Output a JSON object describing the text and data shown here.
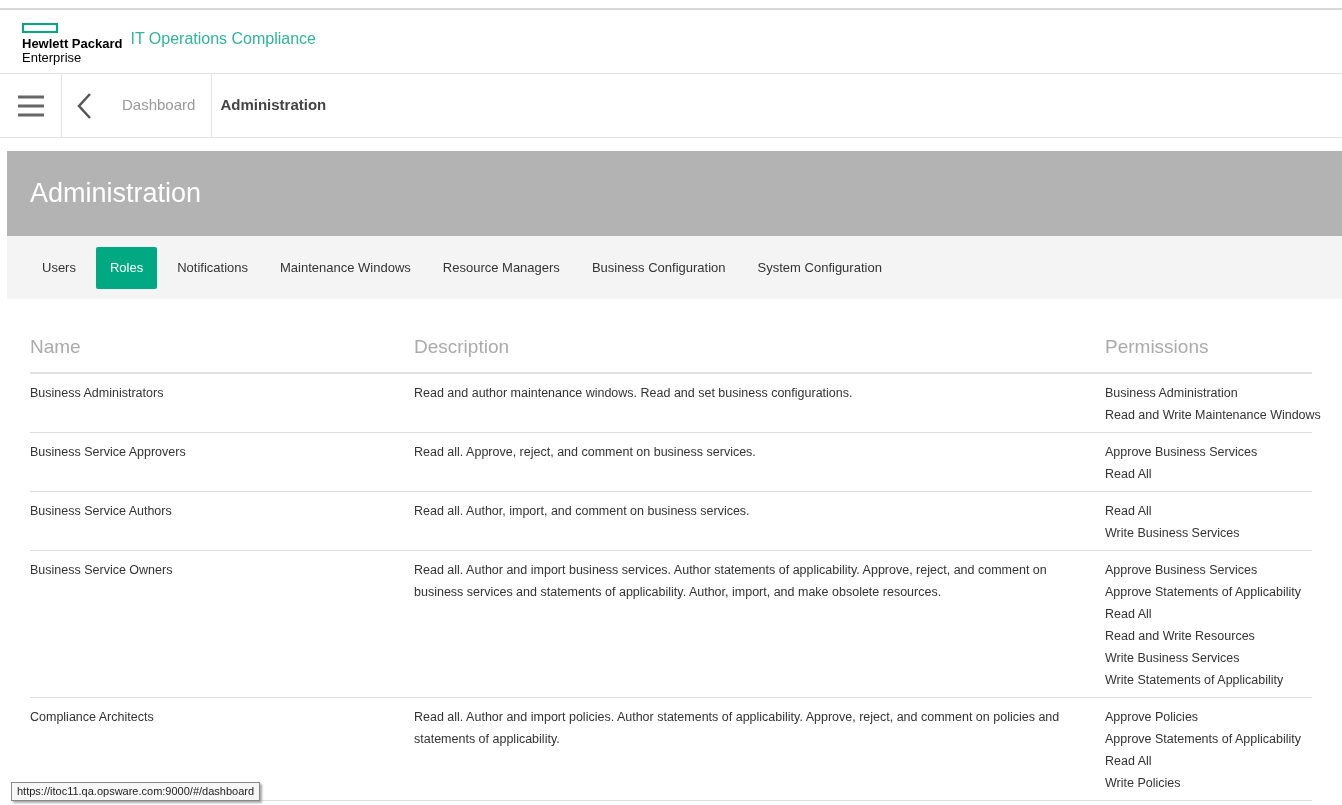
{
  "header": {
    "brand_line1": "Hewlett Packard",
    "brand_line2": "Enterprise",
    "product": "IT Operations Compliance"
  },
  "breadcrumb": [
    {
      "label": "Dashboard",
      "current": false
    },
    {
      "label": "Administration",
      "current": true
    }
  ],
  "banner": {
    "title": "Administration"
  },
  "tabs": [
    {
      "label": "Users",
      "selected": false
    },
    {
      "label": "Roles",
      "selected": true
    },
    {
      "label": "Notifications",
      "selected": false
    },
    {
      "label": "Maintenance Windows",
      "selected": false
    },
    {
      "label": "Resource Managers",
      "selected": false
    },
    {
      "label": "Business Configuration",
      "selected": false
    },
    {
      "label": "System Configuration",
      "selected": false
    }
  ],
  "table": {
    "columns": [
      "Name",
      "Description",
      "Permissions"
    ],
    "rows": [
      {
        "name": "Business Administrators",
        "description": "Read and author maintenance windows. Read and set business configurations.",
        "permissions": [
          "Business Administration",
          "Read and Write Maintenance Windows"
        ]
      },
      {
        "name": "Business Service Approvers",
        "description": "Read all. Approve, reject, and comment on business services.",
        "permissions": [
          "Approve Business Services",
          "Read All"
        ]
      },
      {
        "name": "Business Service Authors",
        "description": "Read all. Author, import, and comment on business services.",
        "permissions": [
          "Read All",
          "Write Business Services"
        ]
      },
      {
        "name": "Business Service Owners",
        "description": "Read all. Author and import business services. Author statements of applicability. Approve, reject, and comment on business services and statements of applicability. Author, import, and make obsolete resources.",
        "permissions": [
          "Approve Business Services",
          "Approve Statements of Applicability",
          "Read All",
          "Read and Write Resources",
          "Write Business Services",
          "Write Statements of Applicability"
        ]
      },
      {
        "name": "Compliance Architects",
        "description": "Read all. Author and import policies. Author statements of applicability. Approve, reject, and comment on policies and statements of applicability.",
        "permissions": [
          "Approve Policies",
          "Approve Statements of Applicability",
          "Read All",
          "Write Policies"
        ]
      }
    ]
  },
  "status_url": "https://itoc11.qa.opsware.com:9000/#/dashboard"
}
